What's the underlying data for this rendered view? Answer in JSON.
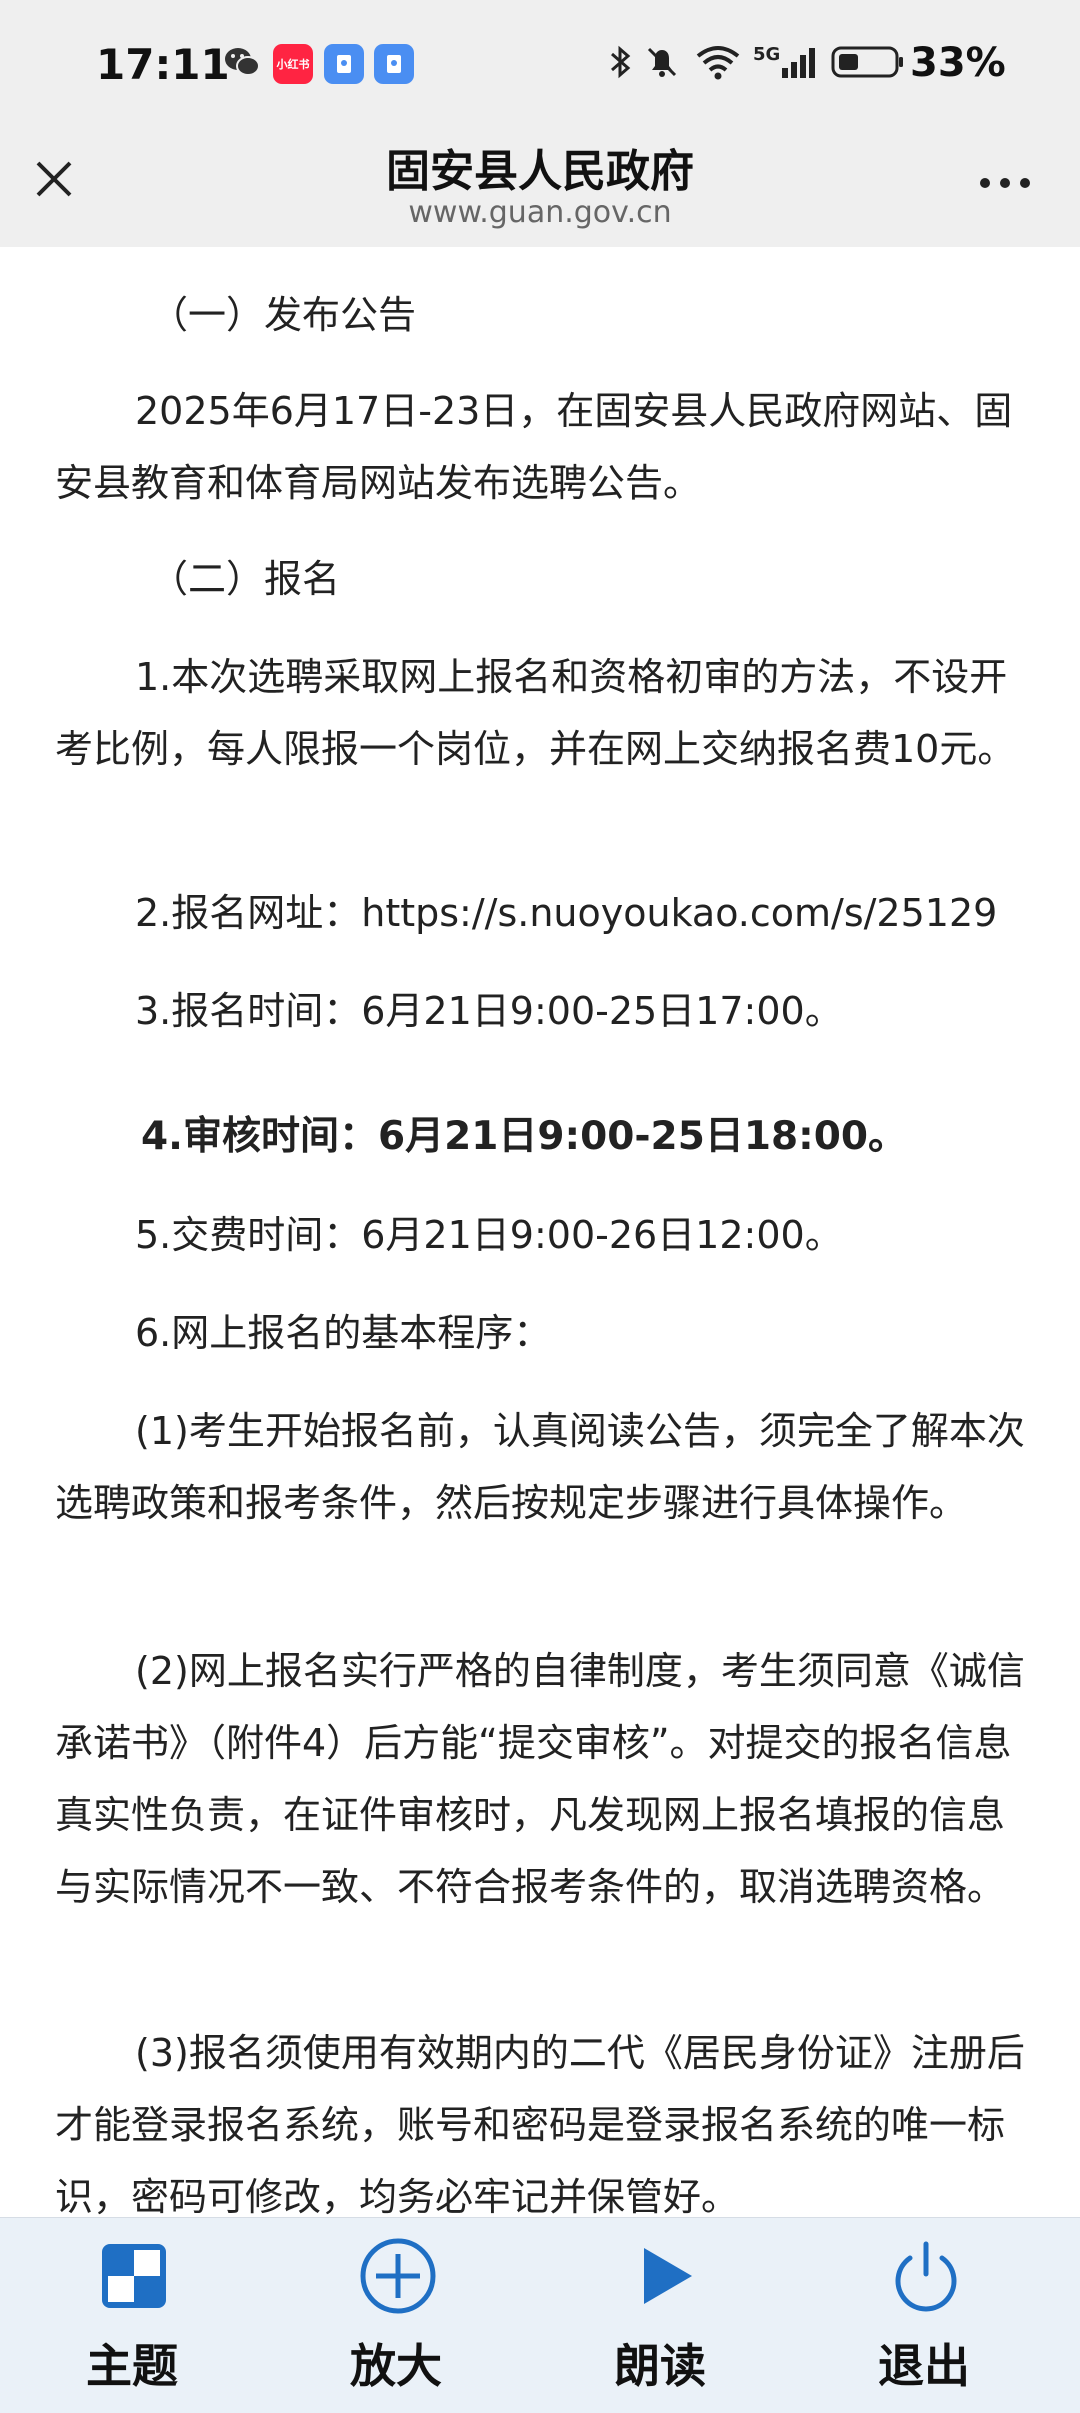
{
  "status_bar": {
    "time": "17:11",
    "app_badge_text": "小红书",
    "network": "5G",
    "battery": "33%"
  },
  "header": {
    "title": "固安县人民政府",
    "url": "www.guan.gov.cn"
  },
  "content": {
    "paragraphs": [
      "（一）发布公告",
      "2025年6月17日-23日，在固安县人民政府网站、固安县教育和体育局网站发布选聘公告。",
      "（二）报名",
      "1.本次选聘采取网上报名和资格初审的方法，不设开考比例，每人限报一个岗位，并在网上交纳报名费10元。",
      "2.报名网址：https://s.nuoyoukao.com/s/25129",
      "3.报名时间：6月21日9:00-25日17:00。",
      "4.审核时间：6月21日9:00-25日18:00。",
      "5.交费时间：6月21日9:00-26日12:00。",
      "6.网上报名的基本程序：",
      "(1)考生开始报名前，认真阅读公告，须完全了解本次选聘政策和报考条件，然后按规定步骤进行具体操作。",
      "(2)网上报名实行严格的自律制度，考生须同意《诚信承诺书》（附件4）后方能“提交审核”。对提交的报名信息真实性负责，在证件审核时，凡发现网上报名填报的信息与实际情况不一致、不符合报考条件的，取消选聘资格。",
      "(3)报名须使用有效期内的二代《居民身份证》注册后才能登录报名系统，账号和密码是登录报名系统的唯一标识，密码可修改，均务必牢记并保管好。"
    ]
  },
  "toolbar": {
    "theme_label": "主题",
    "zoom_label": "放大",
    "read_label": "朗读",
    "exit_label": "退出"
  },
  "colors": {
    "accent": "#1f6fc4",
    "header_bg": "#efefef",
    "toolbar_bg": "#eaf1f8"
  }
}
